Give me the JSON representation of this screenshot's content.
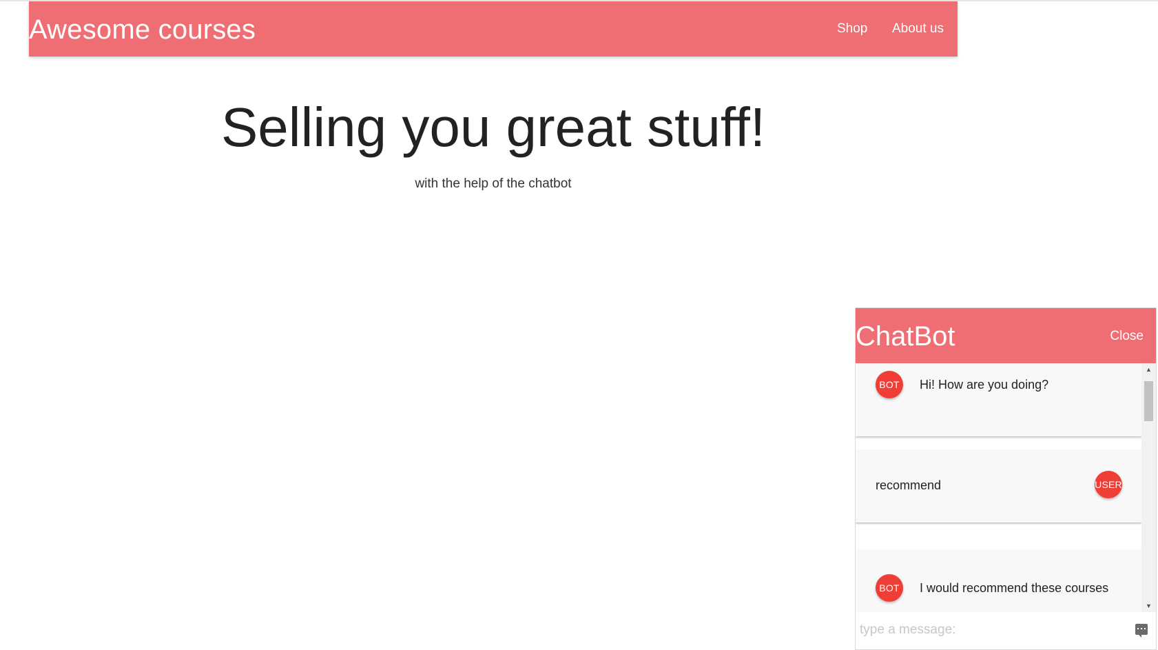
{
  "navbar": {
    "brand": "Awesome courses",
    "links": [
      {
        "label": "Shop"
      },
      {
        "label": "About us"
      }
    ]
  },
  "hero": {
    "title": "Selling you great stuff!",
    "subtitle": "with the help of the chatbot"
  },
  "chat": {
    "title": "ChatBot",
    "close_label": "Close",
    "messages": [
      {
        "sender": "BOT",
        "text": "Hi! How are you doing?"
      },
      {
        "sender": "USER",
        "text": "recommend"
      },
      {
        "sender": "BOT",
        "text": "I would recommend these courses"
      }
    ],
    "input": {
      "placeholder": "type a message:",
      "value": ""
    },
    "icons": {
      "send": "send-message-icon",
      "scroll_up": "scroll-up-arrow-icon",
      "scroll_down": "scroll-down-arrow-icon"
    }
  },
  "colors": {
    "brand": "#ef6e73",
    "avatar": "#ef3e36",
    "text": "#222222"
  }
}
